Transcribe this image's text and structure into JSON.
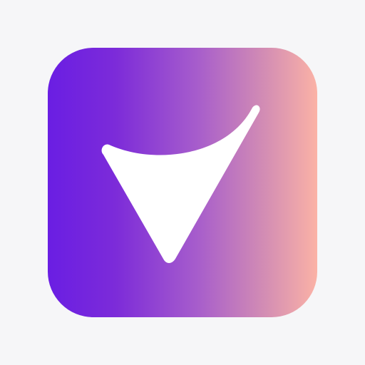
{
  "app_icon": {
    "name": "check-arrow-app-icon",
    "glyph_icon": "checkmark-arrow-icon",
    "colors": {
      "background": "#f6f6f8",
      "gradient_start": "#6a1ee3",
      "gradient_end": "#fbb2a6",
      "glyph": "#ffffff"
    }
  }
}
